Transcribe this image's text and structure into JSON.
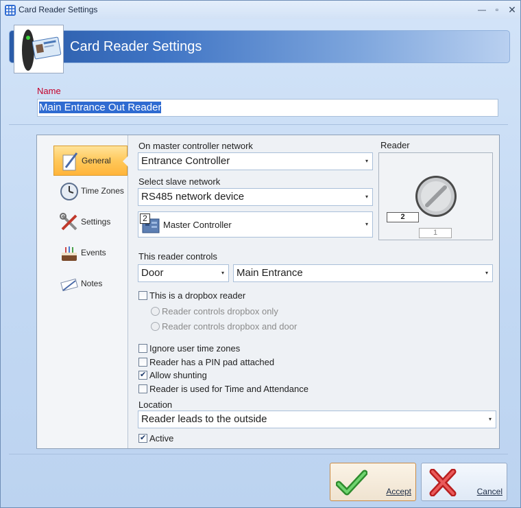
{
  "window": {
    "title": "Card Reader Settings"
  },
  "header": {
    "title": "Card Reader Settings"
  },
  "name_field": {
    "label": "Name",
    "value": "Main Entrance Out Reader"
  },
  "nav": {
    "items": [
      {
        "label": "General",
        "icon": "pen-paper-icon",
        "active": true
      },
      {
        "label": "Time Zones",
        "icon": "clock-icon"
      },
      {
        "label": "Settings",
        "icon": "tools-icon"
      },
      {
        "label": "Events",
        "icon": "cake-icon"
      },
      {
        "label": "Notes",
        "icon": "notes-icon"
      }
    ]
  },
  "general": {
    "master_network_label": "On master controller network",
    "master_network_value": "Entrance Controller",
    "slave_network_label": "Select slave network",
    "slave_network_value": "RS485 network device",
    "slave_device_number": "2",
    "slave_device_value": "Master Controller",
    "reader_label": "Reader",
    "reader_number": "2",
    "reader_secondary_number": "1",
    "controls_label": "This reader controls",
    "controls_type": "Door",
    "controls_target": "Main Entrance",
    "dropbox_label": "This is a dropbox reader",
    "dropbox_checked": false,
    "dropbox_option1": "Reader controls dropbox only",
    "dropbox_option2": "Reader controls dropbox and door",
    "ignore_tz_label": "Ignore user time zones",
    "ignore_tz_checked": false,
    "pin_pad_label": "Reader has a PIN pad attached",
    "pin_pad_checked": false,
    "shunting_label": "Allow shunting",
    "shunting_checked": true,
    "time_attendance_label": "Reader is used for Time and Attendance",
    "time_attendance_checked": false,
    "location_label": "Location",
    "location_value": "Reader leads to the outside",
    "active_label": "Active",
    "active_checked": true
  },
  "buttons": {
    "accept": "Accept",
    "cancel": "Cancel"
  },
  "colors": {
    "accent": "#2a5ba8",
    "name_label": "#c4002a",
    "active_nav": "#ffc85a"
  }
}
